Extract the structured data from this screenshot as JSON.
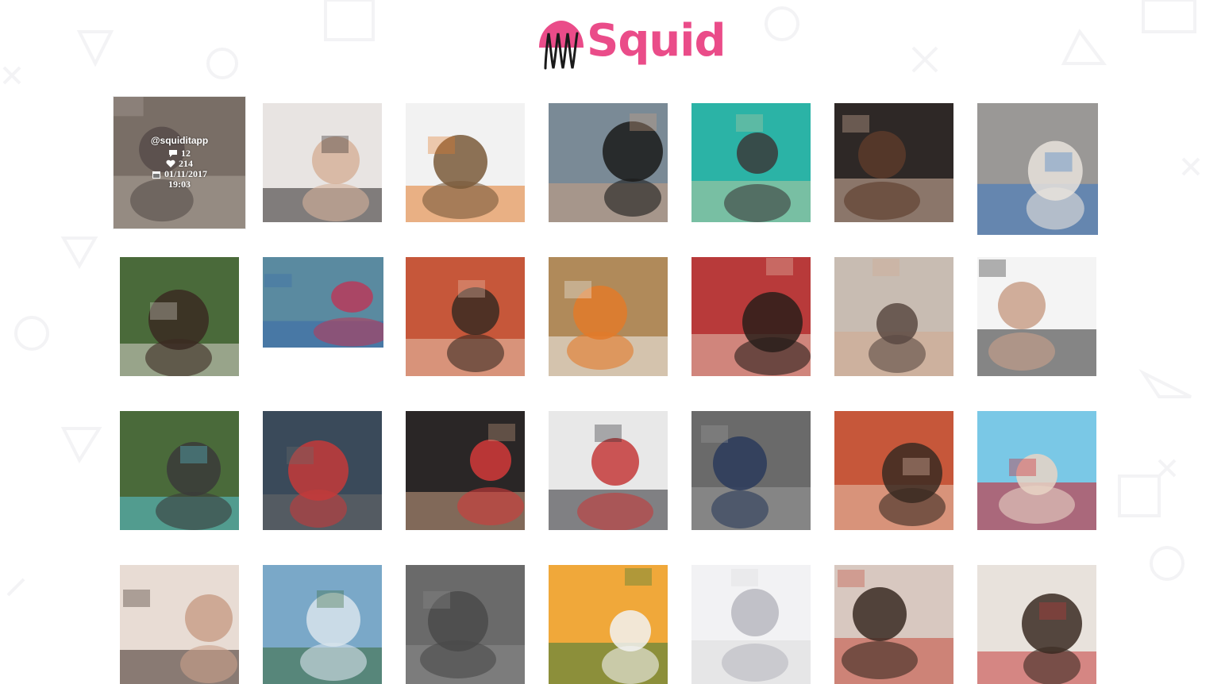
{
  "brand": {
    "name": "Squid",
    "color": "#ea4c89"
  },
  "hover_overlay": {
    "username": "@squiditapp",
    "comments": "12",
    "likes": "214",
    "date": "01/11/2017",
    "time": "19:03",
    "icons": [
      "comment-icon",
      "heart-icon",
      "calendar-icon"
    ]
  },
  "photos": [
    {
      "name": "photo-group-crowd",
      "palette": [
        "#8a7a70",
        "#cfc2b6",
        "#5a4c48"
      ]
    },
    {
      "name": "photo-fringe-bodysuit",
      "palette": [
        "#e8e4e2",
        "#2a2626",
        "#d6b39b"
      ]
    },
    {
      "name": "photo-dogs-food-bag",
      "palette": [
        "#f2f2f2",
        "#e27a2a",
        "#7a5a3a"
      ]
    },
    {
      "name": "photo-sunglasses-selfie",
      "palette": [
        "#7a8a96",
        "#caa184",
        "#1a1a1a"
      ]
    },
    {
      "name": "photo-green-hair-girl",
      "palette": [
        "#2bb3a6",
        "#b8c9a0",
        "#3a3a3a"
      ]
    },
    {
      "name": "photo-brunette-selfie",
      "palette": [
        "#2e2826",
        "#d9b6a2",
        "#5b3a2a"
      ]
    },
    {
      "name": "photo-two-men-tank",
      "palette": [
        "#9a9896",
        "#3a78c4",
        "#e8e2dc"
      ]
    },
    {
      "name": "photo-man-glasses-plants",
      "palette": [
        "#4a6a3a",
        "#d8d4cc",
        "#3a2a22"
      ]
    },
    {
      "name": "photo-desk-flatlay",
      "palette": [
        "#5a8aa0",
        "#3a6aaa",
        "#b83a5a"
      ]
    },
    {
      "name": "photo-5-dicas-instagram",
      "palette": [
        "#c6573a",
        "#e8c4ae",
        "#3a2a22"
      ]
    },
    {
      "name": "photo-cat-dog-floor",
      "palette": [
        "#b08a5a",
        "#f2f2f2",
        "#e27a2a"
      ]
    },
    {
      "name": "photo-smiling-girl-red",
      "palette": [
        "#b83a3a",
        "#e4c2b2",
        "#2a1e1a"
      ]
    },
    {
      "name": "photo-man-in-bed",
      "palette": [
        "#c8bcb2",
        "#d2a88e",
        "#5a4a42"
      ]
    },
    {
      "name": "photo-laughing-girl-summer",
      "palette": [
        "#f4f4f4",
        "#2a2a2a",
        "#c9a08a"
      ]
    },
    {
      "name": "photo-hand-mint-tin",
      "palette": [
        "#4a6a3a",
        "#5ac4d6",
        "#3a3a3a"
      ]
    },
    {
      "name": "photo-office-workspace",
      "palette": [
        "#3a4a5a",
        "#6a6a6a",
        "#c43a3a"
      ]
    },
    {
      "name": "photo-boots-bracelets",
      "palette": [
        "#2a2626",
        "#c8a084",
        "#d23a3a"
      ]
    },
    {
      "name": "photo-squid-event-booth",
      "palette": [
        "#e8e8e8",
        "#2a2a30",
        "#c43a3a"
      ]
    },
    {
      "name": "photo-child-beanie-window",
      "palette": [
        "#6a6a6a",
        "#9a9a9a",
        "#2a3a5a"
      ]
    },
    {
      "name": "photo-datas-comemorativas",
      "palette": [
        "#c6573a",
        "#e8c4ae",
        "#3a2a22"
      ]
    },
    {
      "name": "photo-coca-cola-bottle",
      "palette": [
        "#7ac8e6",
        "#d21a22",
        "#e8d4c4"
      ]
    },
    {
      "name": "photo-row4-girl",
      "palette": [
        "#e8dcd4",
        "#3a2a22",
        "#c9a08a"
      ]
    },
    {
      "name": "photo-row4-landscape",
      "palette": [
        "#7aa8c8",
        "#3a6a3a",
        "#d8e4ec"
      ]
    },
    {
      "name": "photo-row4-gray",
      "palette": [
        "#6a6a6a",
        "#8a8a8a",
        "#4a4a4a"
      ]
    },
    {
      "name": "photo-row4-flowers",
      "palette": [
        "#f0a83a",
        "#3a7a3a",
        "#f2f2f2"
      ]
    },
    {
      "name": "photo-row4-white",
      "palette": [
        "#f2f2f4",
        "#dcdcdc",
        "#b8b8c0"
      ]
    },
    {
      "name": "photo-row4-man",
      "palette": [
        "#d8c8c0",
        "#c44a3a",
        "#3a2a22"
      ]
    },
    {
      "name": "photo-row4-red-girl",
      "palette": [
        "#e8e2dc",
        "#c43a3a",
        "#3a2a22"
      ]
    }
  ]
}
